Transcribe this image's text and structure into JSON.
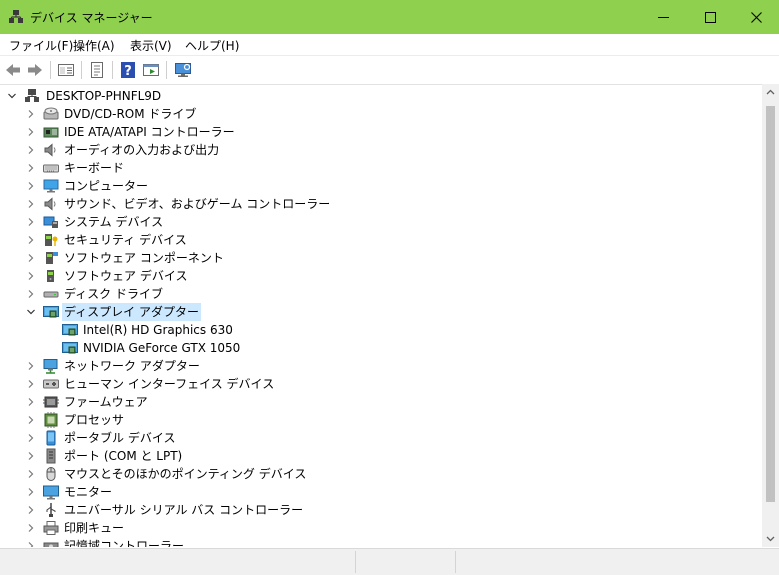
{
  "window": {
    "title": "デバイス マネージャー"
  },
  "menu": [
    "ファイル(F)",
    "操作(A)",
    "表示(V)",
    "ヘルプ(H)"
  ],
  "toolbar": [
    "back-icon",
    "forward-icon",
    "show-hidden-icon",
    "properties-icon",
    "help-icon",
    "action-icon",
    "scan-hardware-icon"
  ],
  "tree": {
    "root": "DESKTOP-PHNFL9D",
    "items": [
      {
        "label": "DVD/CD-ROM ドライブ",
        "icon": "dvd-drive-icon",
        "expanded": false
      },
      {
        "label": "IDE ATA/ATAPI コントローラー",
        "icon": "ide-controller-icon",
        "expanded": false
      },
      {
        "label": "オーディオの入力および出力",
        "icon": "speaker-icon",
        "expanded": false
      },
      {
        "label": "キーボード",
        "icon": "keyboard-icon",
        "expanded": false
      },
      {
        "label": "コンピューター",
        "icon": "computer-icon",
        "expanded": false
      },
      {
        "label": "サウンド、ビデオ、およびゲーム コントローラー",
        "icon": "speaker-icon",
        "expanded": false
      },
      {
        "label": "システム デバイス",
        "icon": "system-device-icon",
        "expanded": false
      },
      {
        "label": "セキュリティ デバイス",
        "icon": "security-device-icon",
        "expanded": false
      },
      {
        "label": "ソフトウェア コンポーネント",
        "icon": "software-component-icon",
        "expanded": false
      },
      {
        "label": "ソフトウェア デバイス",
        "icon": "software-device-icon",
        "expanded": false
      },
      {
        "label": "ディスク ドライブ",
        "icon": "disk-drive-icon",
        "expanded": false
      },
      {
        "label": "ディスプレイ アダプター",
        "icon": "display-adapter-icon",
        "expanded": true,
        "selected": true,
        "children": [
          {
            "label": "Intel(R) HD Graphics 630",
            "icon": "display-adapter-icon"
          },
          {
            "label": "NVIDIA GeForce GTX 1050",
            "icon": "display-adapter-icon"
          }
        ]
      },
      {
        "label": "ネットワーク アダプター",
        "icon": "network-adapter-icon",
        "expanded": false
      },
      {
        "label": "ヒューマン インターフェイス デバイス",
        "icon": "hid-icon",
        "expanded": false
      },
      {
        "label": "ファームウェア",
        "icon": "firmware-icon",
        "expanded": false
      },
      {
        "label": "プロセッサ",
        "icon": "processor-icon",
        "expanded": false
      },
      {
        "label": "ポータブル デバイス",
        "icon": "portable-device-icon",
        "expanded": false
      },
      {
        "label": "ポート (COM と LPT)",
        "icon": "port-icon",
        "expanded": false
      },
      {
        "label": "マウスとそのほかのポインティング デバイス",
        "icon": "mouse-icon",
        "expanded": false
      },
      {
        "label": "モニター",
        "icon": "monitor-icon",
        "expanded": false
      },
      {
        "label": "ユニバーサル シリアル バス コントローラー",
        "icon": "usb-icon",
        "expanded": false
      },
      {
        "label": "印刷キュー",
        "icon": "printer-icon",
        "expanded": false
      },
      {
        "label": "記憶域コントローラー",
        "icon": "storage-controller-icon",
        "expanded": false
      }
    ]
  },
  "colors": {
    "titlebar": "#8fd14f",
    "selection": "#cce8ff",
    "statusbar": "#f0f0f0"
  }
}
